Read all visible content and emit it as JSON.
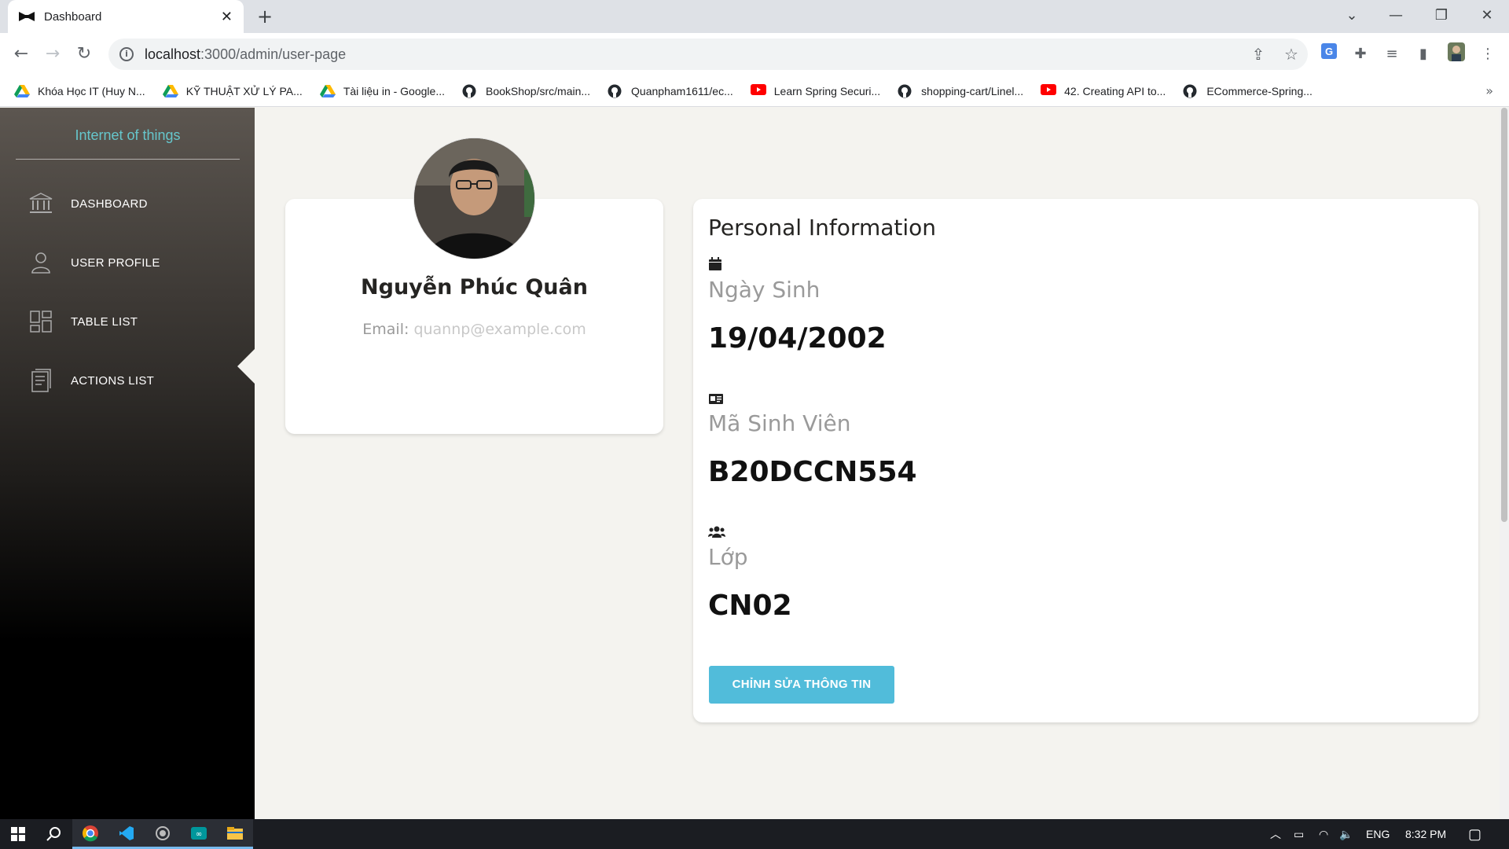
{
  "browser": {
    "tab_title": "Dashboard",
    "url_host": "localhost",
    "url_rest": ":3000/admin/user-page",
    "bookmarks": [
      {
        "label": "Khóa Học IT (Huy N...",
        "icon": "google-drive-icon"
      },
      {
        "label": "KỸ THUẬT XỬ LÝ PA...",
        "icon": "google-drive-icon"
      },
      {
        "label": "Tài liệu in - Google...",
        "icon": "google-drive-icon"
      },
      {
        "label": "BookShop/src/main...",
        "icon": "github-icon"
      },
      {
        "label": "Quanpham1611/ec...",
        "icon": "github-icon"
      },
      {
        "label": "Learn Spring Securi...",
        "icon": "youtube-icon"
      },
      {
        "label": "shopping-cart/Linel...",
        "icon": "github-icon"
      },
      {
        "label": "42. Creating API to...",
        "icon": "youtube-icon"
      },
      {
        "label": "ECommerce-Spring...",
        "icon": "github-icon"
      }
    ],
    "bookmarks_more": "»"
  },
  "sidebar": {
    "brand": "Internet of things",
    "items": [
      {
        "label": "DASHBOARD",
        "icon": "bank-icon"
      },
      {
        "label": "USER PROFILE",
        "icon": "user-icon"
      },
      {
        "label": "TABLE LIST",
        "icon": "grid-icon"
      },
      {
        "label": "ACTIONS LIST",
        "icon": "document-icon"
      }
    ],
    "active_index": 1
  },
  "profile": {
    "name": "Nguyễn Phúc Quân",
    "email_label": "Email:",
    "email": "quannp@example.com"
  },
  "personal_info": {
    "title": "Personal Information",
    "fields": [
      {
        "label": "Ngày Sinh",
        "value": "19/04/2002",
        "icon": "calendar-icon"
      },
      {
        "label": "Mã Sinh Viên",
        "value": "B20DCCN554",
        "icon": "id-card-icon"
      },
      {
        "label": "Lớp",
        "value": "CN02",
        "icon": "users-icon"
      }
    ],
    "edit_button": "CHỈNH SỬA THÔNG TIN"
  },
  "colors": {
    "accent": "#51bcda",
    "brand": "#66c6cc",
    "background": "#f4f3ef"
  },
  "taskbar": {
    "lang": "ENG",
    "time": "8:32 PM"
  }
}
